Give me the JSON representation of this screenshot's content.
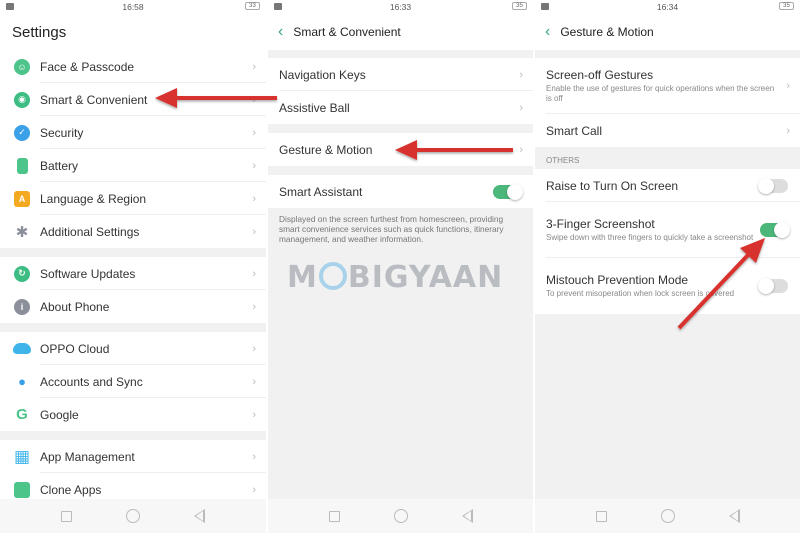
{
  "screens": [
    {
      "status": {
        "time": "16:58",
        "battery": "33"
      },
      "title": "Settings",
      "groups": [
        [
          {
            "label": "Face & Passcode",
            "icon": "face-passcode-icon",
            "color": "#4cc48a"
          },
          {
            "label": "Smart & Convenient",
            "icon": "smart-head-icon",
            "color": "#3dbd83"
          },
          {
            "label": "Security",
            "icon": "shield-icon",
            "color": "#3aa0e8"
          },
          {
            "label": "Battery",
            "icon": "battery-icon",
            "color": "#4cc48a"
          },
          {
            "label": "Language & Region",
            "icon": "language-icon",
            "color": "#f3a920"
          },
          {
            "label": "Additional Settings",
            "icon": "gear-icon",
            "color": "#8a8f99"
          }
        ],
        [
          {
            "label": "Software Updates",
            "icon": "update-icon",
            "color": "#3dbd83"
          },
          {
            "label": "About Phone",
            "icon": "info-icon",
            "color": "#8a8f99"
          }
        ],
        [
          {
            "label": "OPPO Cloud",
            "icon": "cloud-icon",
            "color": "#3fb4ea"
          },
          {
            "label": "Accounts and Sync",
            "icon": "account-icon",
            "color": "#3aa0e8"
          },
          {
            "label": "Google",
            "icon": "google-icon",
            "color": "#4cc48a"
          }
        ],
        [
          {
            "label": "App Management",
            "icon": "apps-grid-icon",
            "color": "#3fb4ea"
          },
          {
            "label": "Clone Apps",
            "icon": "clone-apps-icon",
            "color": "#4cc48a"
          }
        ]
      ]
    },
    {
      "status": {
        "time": "16:33",
        "battery": "35"
      },
      "title": "Smart & Convenient",
      "items": [
        {
          "label": "Navigation Keys"
        },
        {
          "label": "Assistive Ball"
        },
        {
          "label": "Gesture & Motion"
        }
      ],
      "smart_assistant": {
        "label": "Smart Assistant",
        "enabled": true,
        "description": "Displayed on the screen furthest from homescreen, providing smart convenience services such as quick functions, itinerary management, and weather information."
      }
    },
    {
      "status": {
        "time": "16:34",
        "battery": "35"
      },
      "title": "Gesture & Motion",
      "items": [
        {
          "label": "Screen-off Gestures",
          "sub": "Enable the use of gestures for quick operations when the screen is off"
        },
        {
          "label": "Smart Call"
        }
      ],
      "section_header": "OTHERS",
      "toggles": [
        {
          "label": "Raise to Turn On Screen",
          "sub": "",
          "enabled": false
        },
        {
          "label": "3-Finger Screenshot",
          "sub": "Swipe down with three fingers to quickly take a screenshot",
          "enabled": true
        },
        {
          "label": "Mistouch Prevention Mode",
          "sub": "To prevent misoperation when lock screen is covered",
          "enabled": false
        }
      ]
    }
  ],
  "chevron": "›",
  "back": "‹",
  "watermark": {
    "pre": "M",
    "post": "BIGYAAN"
  },
  "colors": {
    "accent": "#4bb77a",
    "arrow": "#d8332e"
  }
}
